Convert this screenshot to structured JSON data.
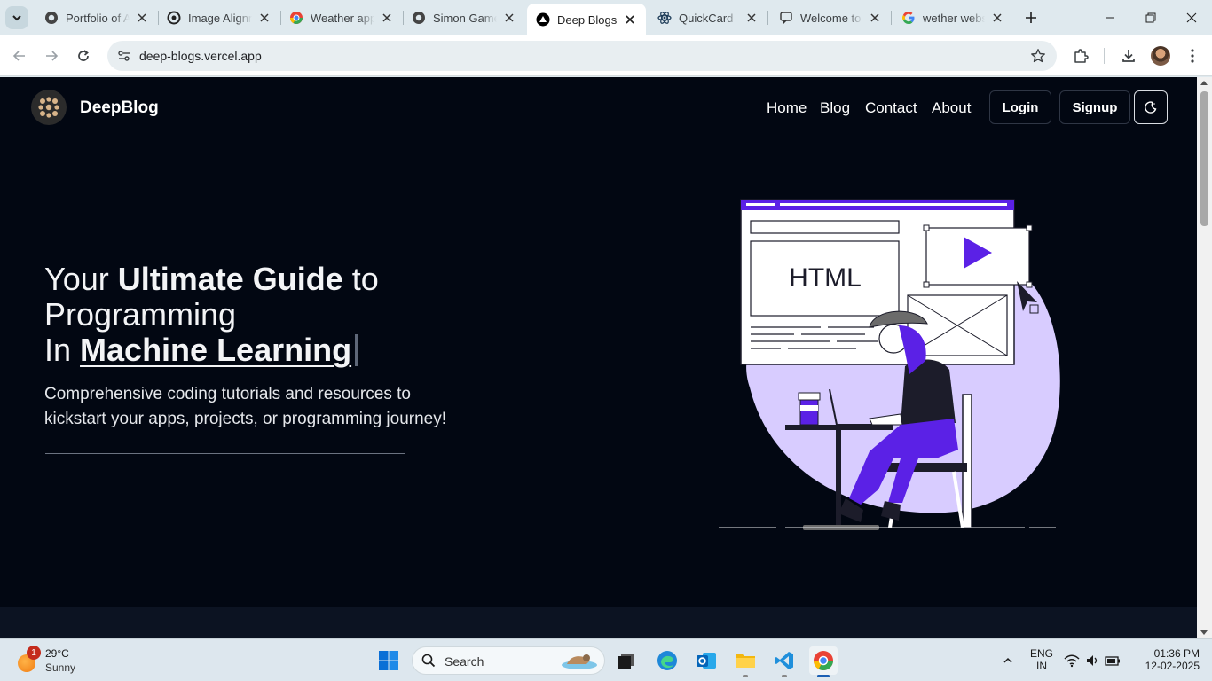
{
  "browser": {
    "tabs": [
      {
        "label": "Portfolio of Abhinav",
        "favicon": "github-icon"
      },
      {
        "label": "Image Alignment",
        "favicon": "openai-icon"
      },
      {
        "label": "Weather app",
        "favicon": "chrome-icon"
      },
      {
        "label": "Simon Game",
        "favicon": "github-icon"
      },
      {
        "label": "Deep Blogs",
        "favicon": "vercel-icon",
        "active": true
      },
      {
        "label": "QuickCard",
        "favicon": "react-icon"
      },
      {
        "label": "Welcome to",
        "favicon": "chat-icon"
      },
      {
        "label": "wether webs",
        "favicon": "google-icon"
      }
    ],
    "url": "deep-blogs.vercel.app"
  },
  "site": {
    "brand": "DeepBlog",
    "nav": {
      "home": "Home",
      "blog": "Blog",
      "contact": "Contact",
      "about": "About",
      "login": "Login",
      "signup": "Signup"
    },
    "hero": {
      "title_part1": "Your ",
      "title_bold": "Ultimate Guide",
      "title_part2": " to",
      "title_line2": "Programming",
      "title_line3_prefix": "In ",
      "typed_text": "Machine Learning",
      "subtitle": "Comprehensive coding tutorials and resources to kickstart your apps, projects, or programming journey!"
    },
    "illustration": {
      "screen_text": "HTML"
    }
  },
  "taskbar": {
    "weather_temp": "29°C",
    "weather_cond": "Sunny",
    "weather_badge": "1",
    "search_label": "Search",
    "lang_line1": "ENG",
    "lang_line2": "IN",
    "time": "01:36 PM",
    "date": "12-02-2025"
  },
  "colors": {
    "page_bg": "#020712",
    "accent_purple": "#5b21e6",
    "illustration_blob": "#d8ccff"
  }
}
